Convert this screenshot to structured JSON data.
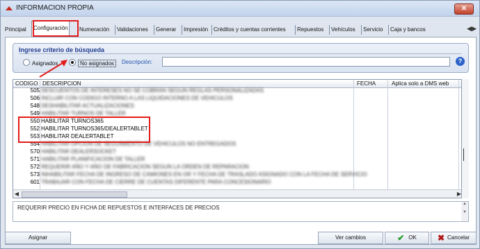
{
  "window": {
    "title": "INFORMACION PROPIA",
    "close_label": "✕"
  },
  "tabs": [
    {
      "label": "Principal"
    },
    {
      "label": "Configuración",
      "active": true
    },
    {
      "label": "Numeración"
    },
    {
      "label": "Validaciones"
    },
    {
      "label": "Generar"
    },
    {
      "label": "Impresión"
    },
    {
      "label": "Créditos y cuentas corrientes"
    },
    {
      "label": "Repuestos"
    },
    {
      "label": "Vehículos"
    },
    {
      "label": "Servicio"
    },
    {
      "label": "Caja y bancos"
    }
  ],
  "tab_scroll": "◀▶",
  "criteria": {
    "title": "Ingrese criterio de búsqueda",
    "option_assigned": "Asignados",
    "option_unassigned": "No asignados",
    "selected": "No asignados",
    "description_label": "Descripción:",
    "description_value": "",
    "help_icon": "question-icon",
    "help_glyph": "?"
  },
  "grid": {
    "columns": [
      "CODIGO",
      "DESCRIPCION",
      "FECHA",
      "Aplica solo a DMS web"
    ],
    "rows": [
      {
        "code": "505",
        "description": "DESCUENTOS DE INTERESES NO SE COBRAN SEGUN REGLAS PERSONALIZADAS",
        "blurred": true
      },
      {
        "code": "506",
        "description": "INCLUIR CON CODIGO INTERNO A LAS LIQUIDACIONES DE VEHICULOS",
        "blurred": true
      },
      {
        "code": "548",
        "description": "DESHABILITAR ACTUALIZACIONES",
        "blurred": true
      },
      {
        "code": "549",
        "description": "HABILITAR TURNOS DE TALLER",
        "blurred": true
      },
      {
        "code": "550",
        "description": "HABILITAR TURNOS365",
        "blurred": false
      },
      {
        "code": "552",
        "description": "HABILITAR TURNOS365/DEALERTABLET",
        "blurred": false
      },
      {
        "code": "553",
        "description": "HABILITAR DEALERTABLET",
        "blurred": false
      },
      {
        "code": "554",
        "description": "HABILITAR OPCION DE SEGUIMIENTO DE VEHICULOS NO ENTREGADOS",
        "blurred": true
      },
      {
        "code": "570",
        "description": "HABILITAR DEALERSOCKET",
        "blurred": true
      },
      {
        "code": "571",
        "description": "HABILITAR PLANIFICACION DE TALLER",
        "blurred": true
      },
      {
        "code": "572",
        "description": "REQUERIR AÑO Y AÑO DE FABRICACION SEGUN LA ORDEN DE REPARACION",
        "blurred": true
      },
      {
        "code": "573",
        "description": "INHABILITAR FECHA DE INGRESO DE CAMIONES EN OR Y FECHA DE TRASLADO ASIGNADO CON LA FECHA DE SERVICIO",
        "blurred": true
      },
      {
        "code": "601",
        "description": "TRABAJAR CON FECHA DE CIERRE DE CUENTAS DIFERENTE PARA CONCESIONARIO",
        "blurred": true
      }
    ]
  },
  "note": {
    "text": "REQUERIR PRECIO EN FICHA DE REPUESTOS E INTERFACES DE PRECIOS"
  },
  "buttons": {
    "assign": "Asignar",
    "view_changes": "Ver cambios",
    "ok": "OK",
    "cancel": "Cancelar",
    "ok_glyph": "✔",
    "cancel_glyph": "✖"
  },
  "colors": {
    "highlight_red": "#e21b1b",
    "title_blue": "#1e3a8f",
    "help_blue": "#2b63c9"
  }
}
